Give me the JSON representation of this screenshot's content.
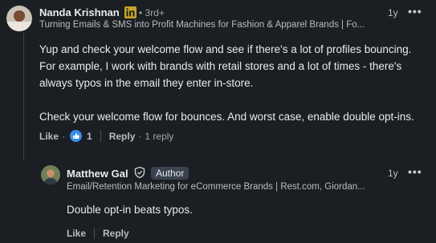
{
  "comment": {
    "author": "Nanda Krishnan",
    "degree": "• 3rd+",
    "headline": "Turning Emails & SMS into Profit Machines for Fashion & Apparel Brands | Fo...",
    "time": "1y",
    "more": "•••",
    "paragraph1_line1": "Yup and check your welcome flow and see if there's a lot of profiles bouncing.",
    "paragraph1_line2": "For example, I work with brands with retail stores and a lot of times - there's",
    "paragraph1_line3": "always typos in the email they enter in-store.",
    "paragraph2": "Check your welcome flow for bounces. And worst case, enable double opt-ins.",
    "like_label": "Like",
    "dot": "·",
    "reaction_count": "1",
    "reply_label": "Reply",
    "reply_count": "1 reply"
  },
  "reply": {
    "author": "Matthew Gal",
    "author_badge": "Author",
    "headline": "Email/Retention Marketing for eCommerce Brands | Rest.com, Giordan...",
    "time": "1y",
    "more": "•••",
    "text": "Double opt-in beats typos.",
    "like_label": "Like",
    "reply_label": "Reply"
  },
  "colors": {
    "background": "#1b1f23",
    "linkedin_blue": "#0a66c2",
    "like_blue": "#378fe9"
  },
  "icons": {
    "linkedin_badge": "linkedin-logo-icon",
    "verified": "verified-shield-icon",
    "like_reaction": "thumbs-up-reaction-icon",
    "more": "more-options-icon"
  }
}
